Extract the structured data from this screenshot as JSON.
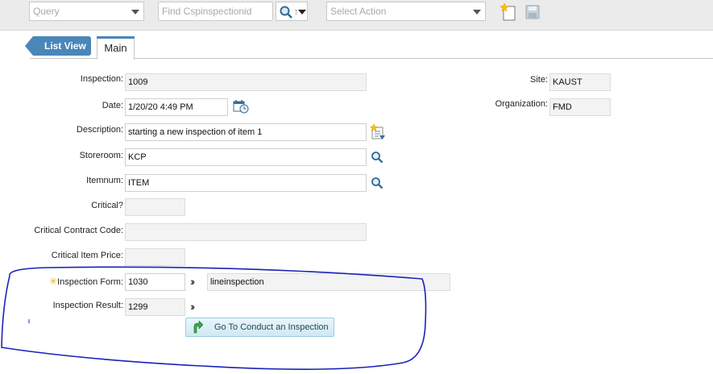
{
  "toolbar": {
    "query_placeholder": "Query",
    "find_placeholder": "Find Cspinspectionid",
    "action_placeholder": "Select Action",
    "icons": [
      "search-icon",
      "chevron-down-icon",
      "new-record-icon",
      "save-icon"
    ]
  },
  "tabs": {
    "list_view": "List View",
    "main": "Main"
  },
  "form": {
    "inspection_label": "Inspection:",
    "inspection_value": "1009",
    "date_label": "Date:",
    "date_value": "1/20/20 4:49 PM",
    "description_label": "Description:",
    "description_value": "starting a new inspection of item 1",
    "storeroom_label": "Storeroom:",
    "storeroom_value": "KCP",
    "itemnum_label": "Itemnum:",
    "itemnum_value": "ITEM",
    "critical_label": "Critical?",
    "critical_value": "",
    "critical_contract_label": "Critical Contract Code:",
    "critical_contract_value": "",
    "critical_price_label": "Critical Item Price:",
    "critical_price_value": "",
    "inspection_form_required_mark": "✳",
    "inspection_form_label": "Inspection Form:",
    "inspection_form_value": "1030",
    "inspection_form_desc": "lineinspection",
    "inspection_result_label": "Inspection Result:",
    "inspection_result_value": "1299",
    "conduct_button": "Go To Conduct an Inspection"
  },
  "side": {
    "site_label": "Site:",
    "site_value": "KAUST",
    "org_label": "Organization:",
    "org_value": "FMD"
  },
  "colors": {
    "tab_blue": "#4a86b8",
    "annotation_blue": "#1a22b8"
  }
}
